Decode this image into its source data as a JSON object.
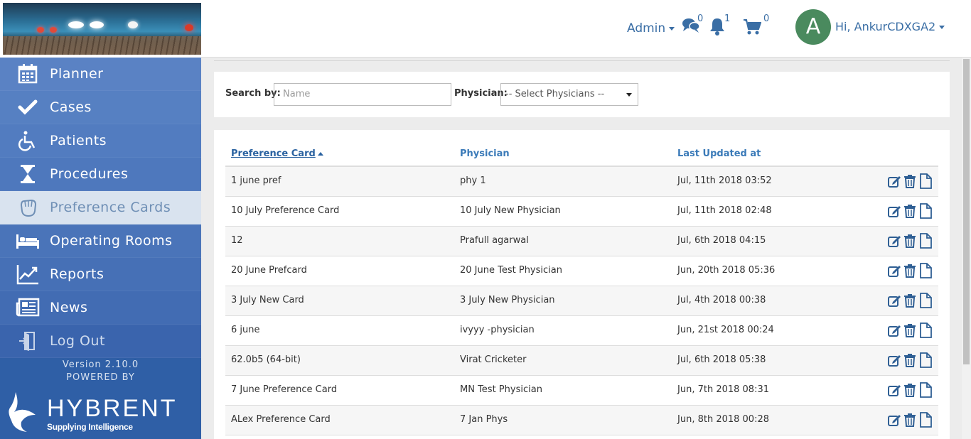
{
  "header": {
    "admin_label": "Admin",
    "messages_count": "0",
    "notifications_count": "1",
    "cart_count": "0",
    "avatar_letter": "A",
    "greeting": "Hi, AnkurCDXGA2"
  },
  "sidebar": {
    "items": [
      {
        "label": "Planner",
        "icon": "calendar-icon"
      },
      {
        "label": "Cases",
        "icon": "checkmark-icon"
      },
      {
        "label": "Patients",
        "icon": "wheelchair-icon"
      },
      {
        "label": "Procedures",
        "icon": "hourglass-icon"
      },
      {
        "label": "Preference Cards",
        "icon": "glove-icon",
        "active": true
      },
      {
        "label": "Operating Rooms",
        "icon": "bed-icon"
      },
      {
        "label": "Reports",
        "icon": "chart-line-icon"
      },
      {
        "label": "News",
        "icon": "newspaper-icon"
      },
      {
        "label": "Log Out",
        "icon": "door-exit-icon"
      }
    ],
    "version": "Version 2.10.0",
    "powered_by": "POWERED BY",
    "brand_name": "HYBRENT",
    "brand_tagline": "Supplying Intelligence"
  },
  "filters": {
    "search_label": "Search by:",
    "search_placeholder": "Name",
    "physician_label": "Physician:",
    "physician_selected": "-- Select Physicians --"
  },
  "table": {
    "columns": [
      "Preference Card",
      "Physician",
      "Last Updated at"
    ],
    "rows": [
      [
        "1 june pref",
        "phy 1",
        "Jul, 11th 2018 03:52"
      ],
      [
        "10 July Preference Card",
        "10 July New Physician",
        "Jul, 11th 2018 02:48"
      ],
      [
        "12",
        "Prafull agarwal",
        "Jul, 6th 2018 04:15"
      ],
      [
        "20 June Prefcard",
        "20 June Test Physician",
        "Jun, 20th 2018 05:36"
      ],
      [
        "3 July New Card",
        "3 July New Physician",
        "Jul, 4th 2018 00:38"
      ],
      [
        "6 june",
        "ivyyy -physician",
        "Jun, 21st 2018 00:24"
      ],
      [
        "62.0b5 (64-bit)",
        "Virat Cricketer",
        "Jul, 6th 2018 05:38"
      ],
      [
        "7 June Preference Card",
        "MN Test Physician",
        "Jun, 7th 2018 08:31"
      ],
      [
        "ALex Preference Card",
        "7 Jan Phys",
        "Jun, 8th 2018 00:28"
      ]
    ]
  },
  "colors": {
    "sidebar": "#2f5fa6",
    "accent": "#3a6ea5",
    "avatar": "#4a8a5e"
  }
}
